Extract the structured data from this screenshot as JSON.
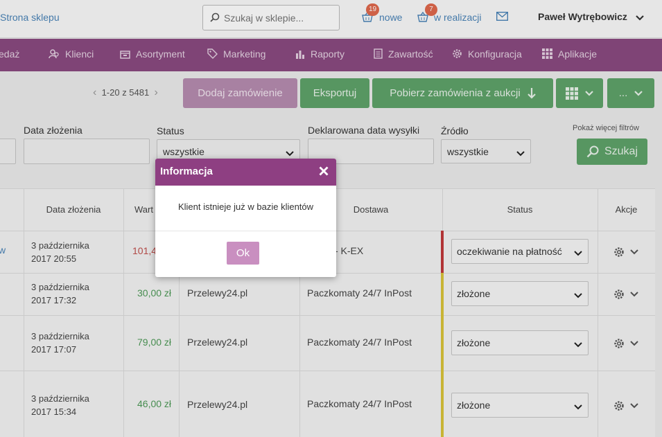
{
  "topbar": {
    "store_link": "Strona sklepu",
    "search_placeholder": "Szukaj w sklepie...",
    "new_count": "19",
    "new_label": "nowe",
    "inprogress_count": "7",
    "inprogress_label": "w realizacji",
    "user_name": "Paweł Wytrębowicz"
  },
  "nav": {
    "items": [
      {
        "label": "edaż",
        "icon": "none"
      },
      {
        "label": "Klienci",
        "icon": "users-icon"
      },
      {
        "label": "Asortyment",
        "icon": "box-icon"
      },
      {
        "label": "Marketing",
        "icon": "tag-icon"
      },
      {
        "label": "Raporty",
        "icon": "bar-chart-icon"
      },
      {
        "label": "Zawartość",
        "icon": "document-icon"
      },
      {
        "label": "Konfiguracja",
        "icon": "gear-icon"
      },
      {
        "label": "Aplikacje",
        "icon": "grid-icon"
      }
    ]
  },
  "toolbar": {
    "pager": "1-20 z 5481",
    "add_order": "Dodaj zamówienie",
    "export": "Eksportuj",
    "fetch_auctions": "Pobierz zamówienia z aukcji",
    "more": "..."
  },
  "filters": {
    "date_label": "Data złożenia",
    "status_label": "Status",
    "status_value": "wszystkie",
    "ship_label": "Deklarowana data wysyłki",
    "source_label": "Źródło",
    "source_value": "wszystkie",
    "more_filters": "Pokaż więcej filtrów",
    "search_btn": "Szukaj"
  },
  "table": {
    "headers": {
      "date": "Data złożenia",
      "value": "Wart",
      "delivery": "Dostawa",
      "status": "Status",
      "actions": "Akcje"
    },
    "rows": [
      {
        "left": "w",
        "date": "3 października 2017 20:55",
        "value": "101,4",
        "payment": "",
        "delivery": "- K-EX",
        "status": "oczekiwanie  na  płatność",
        "stripe": "#c0393b"
      },
      {
        "left": "",
        "date": "3 października 2017 17:32",
        "value": "30,00 zł",
        "payment": "Przelewy24.pl",
        "delivery": "Paczkomaty 24/7 InPost",
        "status": "złożone",
        "stripe": "#d9c43a"
      },
      {
        "left": "",
        "date": "3 października 2017 17:07",
        "value": "79,00 zł",
        "payment": "Przelewy24.pl",
        "delivery": "Paczkomaty 24/7 InPost",
        "status": "złożone",
        "stripe": "#d9c43a"
      },
      {
        "left": "",
        "date": "3 października 2017 15:34",
        "value": "46,00 zł",
        "payment": "Przelewy24.pl",
        "delivery": "Paczkomaty 24/7 InPost",
        "status": "złożone",
        "stripe": "#d9c43a"
      }
    ]
  },
  "modal": {
    "title": "Informacja",
    "message": "Klient istnieje już w bazie klientów",
    "ok": "Ok"
  }
}
